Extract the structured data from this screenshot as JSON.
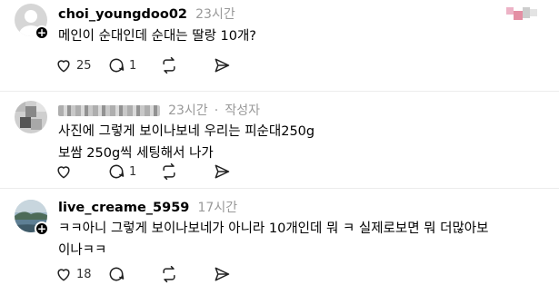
{
  "posts": [
    {
      "username": "choi_youngdoo02",
      "time": "23시간",
      "lines": [
        "메인이 순대인데 순대는 딸랑 10개?"
      ],
      "likes": "25",
      "comments": "1",
      "avatar_icon": "default-avatar-icon"
    },
    {
      "username": "",
      "username_blurred": true,
      "time": "23시간",
      "separator": "·",
      "author_badge": "작성자",
      "lines": [
        "사진에 그렇게 보이나보네 우리는 피순대250g",
        "보쌈 250g씩 세팅해서 나가"
      ],
      "likes": "",
      "comments": "1",
      "avatar_icon": "blurred-avatar-icon"
    },
    {
      "username": "live_creame_5959",
      "time": "17시간",
      "lines": [
        "ㅋㅋ아니 그렇게 보이나보네가 아니라 10개인데 뭐 ㅋ 실제로보면 뭐 더많아보",
        "이나ㅋㅋ"
      ],
      "likes": "18",
      "comments": "",
      "avatar_icon": "landscape-avatar-icon"
    }
  ],
  "colors": {
    "muted": "#999999",
    "accent_text": "#000000",
    "badge_pink": "#e8749a"
  }
}
